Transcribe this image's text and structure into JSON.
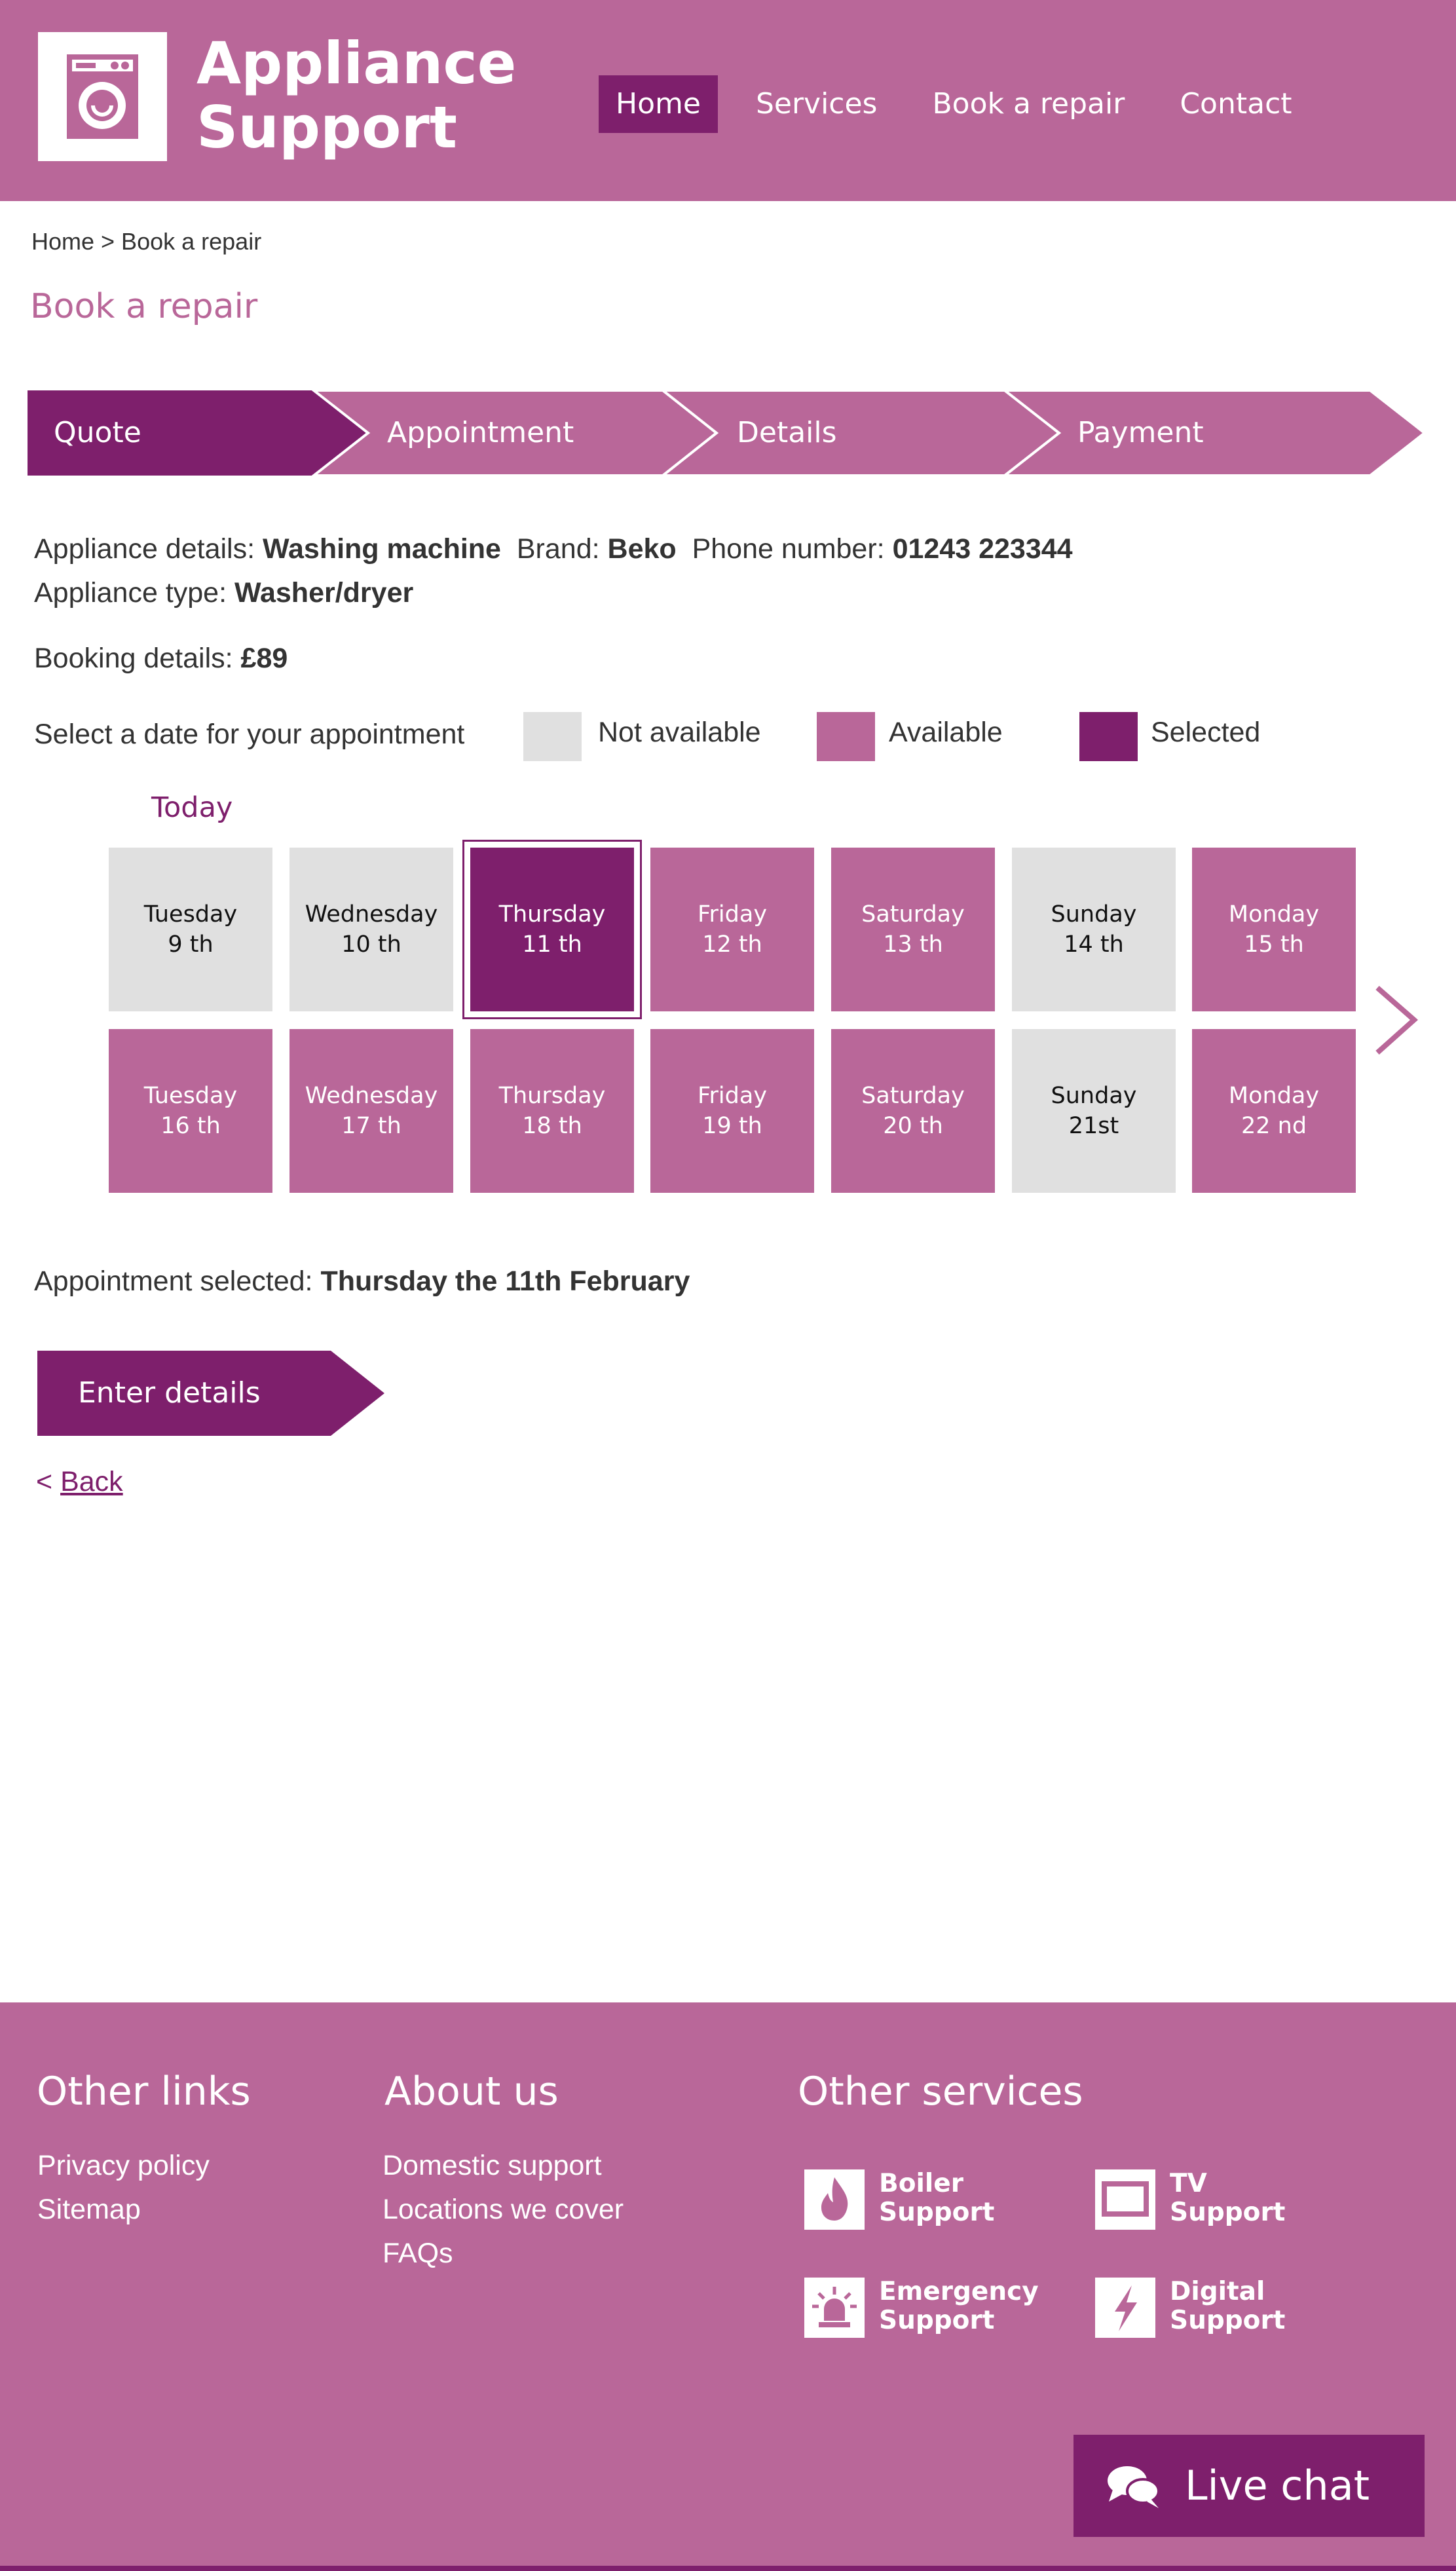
{
  "header": {
    "logo_line1": "Appliance",
    "logo_line2": "Support",
    "nav": [
      {
        "label": "Home",
        "active": true
      },
      {
        "label": "Services"
      },
      {
        "label": "Book a repair"
      },
      {
        "label": "Contact"
      }
    ]
  },
  "breadcrumb": "Home > Book a repair",
  "page_title": "Book a repair",
  "steps": [
    {
      "label": "Quote",
      "active": true
    },
    {
      "label": "Appointment"
    },
    {
      "label": "Details"
    },
    {
      "label": "Payment"
    }
  ],
  "appliance": {
    "details_label": "Appliance details: ",
    "details_value": "Washing machine",
    "brand_label": "Brand: ",
    "brand_value": "Beko",
    "phone_label": "Phone number: ",
    "phone_value": "01243 223344",
    "type_label": "Appliance type: ",
    "type_value": "Washer/dryer"
  },
  "booking": {
    "label": "Booking details: ",
    "value": "£89"
  },
  "calendar": {
    "prompt": "Select a date for your appointment",
    "legend": {
      "not_available": "Not available",
      "available": "Available",
      "selected": "Selected"
    },
    "today_label": "Today",
    "week1": [
      {
        "day": "Tuesday",
        "date": "9 th",
        "status": "na"
      },
      {
        "day": "Wednesday",
        "date": "10 th",
        "status": "na"
      },
      {
        "day": "Thursday",
        "date": "11 th",
        "status": "sel"
      },
      {
        "day": "Friday",
        "date": "12 th",
        "status": "avail"
      },
      {
        "day": "Saturday",
        "date": "13 th",
        "status": "avail"
      },
      {
        "day": "Sunday",
        "date": "14 th",
        "status": "na"
      },
      {
        "day": "Monday",
        "date": "15 th",
        "status": "avail"
      }
    ],
    "week2": [
      {
        "day": "Tuesday",
        "date": "16 th",
        "status": "avail"
      },
      {
        "day": "Wednesday",
        "date": "17 th",
        "status": "avail"
      },
      {
        "day": "Thursday",
        "date": "18 th",
        "status": "avail"
      },
      {
        "day": "Friday",
        "date": "19 th",
        "status": "avail"
      },
      {
        "day": "Saturday",
        "date": "20 th",
        "status": "avail"
      },
      {
        "day": "Sunday",
        "date": "21st",
        "status": "na"
      },
      {
        "day": "Monday",
        "date": "22 nd",
        "status": "avail"
      }
    ]
  },
  "appointment": {
    "label": "Appointment selected: ",
    "value": "Thursday the 11th February"
  },
  "enter_details_label": "Enter details",
  "back": {
    "prefix": "< ",
    "label": "Back"
  },
  "footer": {
    "other_links": {
      "heading": "Other links",
      "links": [
        "Privacy policy",
        "Sitemap"
      ]
    },
    "about_us": {
      "heading": "About us",
      "links": [
        "Domestic support",
        "Locations we cover",
        "FAQs"
      ]
    },
    "other_services": {
      "heading": "Other services",
      "items": [
        {
          "line1": "Boiler",
          "line2": "Support",
          "icon": "flame-icon"
        },
        {
          "line1": "TV",
          "line2": "Support",
          "icon": "tv-icon"
        },
        {
          "line1": "Emergency",
          "line2": "Support",
          "icon": "siren-icon"
        },
        {
          "line1": "Digital",
          "line2": "Support",
          "icon": "lightning-icon"
        }
      ]
    }
  },
  "live_chat_label": "Live chat",
  "colors": {
    "primary": "#b96799",
    "dark": "#7e1f6c",
    "unavailable": "#e0e0e0"
  }
}
